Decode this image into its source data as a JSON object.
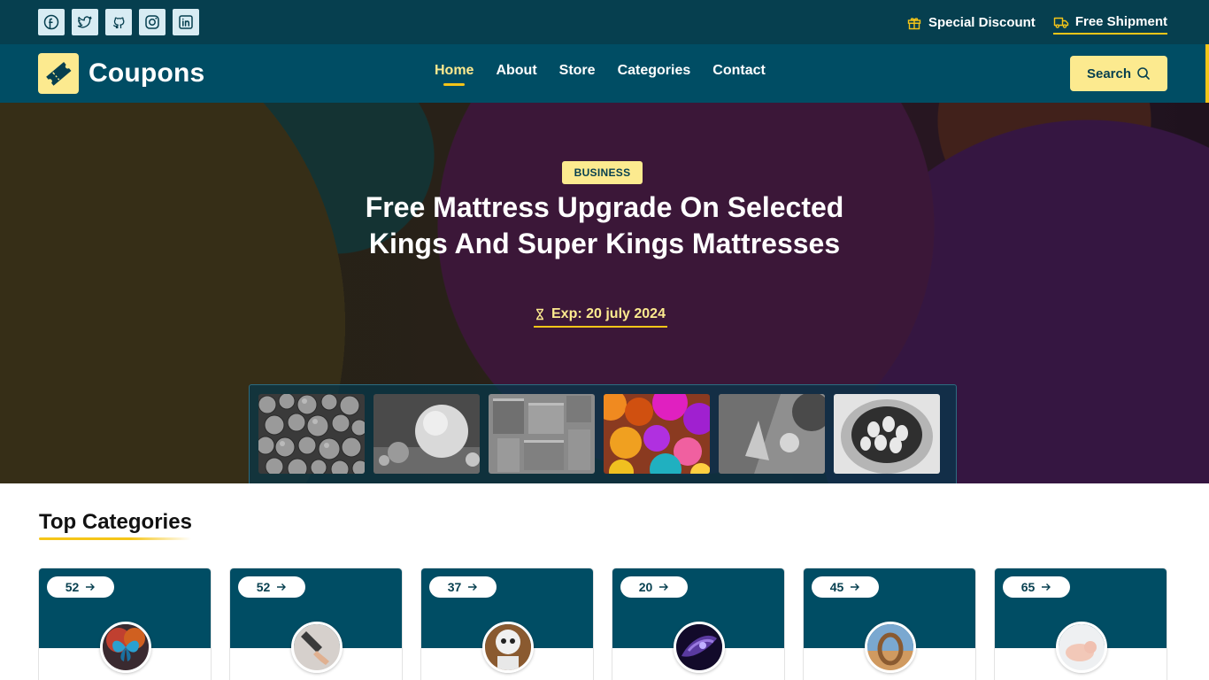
{
  "social": {
    "icons": [
      "facebook-icon",
      "twitter-icon",
      "github-icon",
      "instagram-icon",
      "linkedin-icon"
    ]
  },
  "topbar": {
    "discount_label": "Special Discount",
    "shipment_label": "Free Shipment"
  },
  "header": {
    "logo_text": "Coupons",
    "search_label": "Search"
  },
  "nav": {
    "items": [
      {
        "label": "Home",
        "active": true
      },
      {
        "label": "About"
      },
      {
        "label": "Store"
      },
      {
        "label": "Categories"
      },
      {
        "label": "Contact"
      }
    ]
  },
  "hero": {
    "badge": "BUSINESS",
    "title": "Free Mattress Upgrade On Selected Kings And Super Kings Mattresses",
    "expiry": "Exp: 20 july 2024"
  },
  "categories": {
    "title": "Top Categories",
    "cards": [
      {
        "count": "52"
      },
      {
        "count": "52"
      },
      {
        "count": "37"
      },
      {
        "count": "20"
      },
      {
        "count": "45"
      },
      {
        "count": "65"
      }
    ]
  },
  "colors": {
    "topbar": "#063f4f",
    "navbar": "#004d64",
    "accent": "#fcea8f",
    "underline": "#f5c518"
  }
}
